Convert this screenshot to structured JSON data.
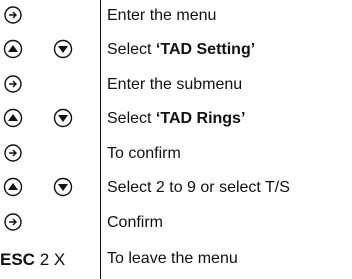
{
  "steps": [
    {
      "keys": [
        "ok-icon"
      ],
      "text": "Enter the menu"
    },
    {
      "keys": [
        "up-icon",
        "down-icon"
      ],
      "text": "Select ",
      "bold": "‘TAD Setting’"
    },
    {
      "keys": [
        "ok-icon"
      ],
      "text": "Enter the submenu"
    },
    {
      "keys": [
        "up-icon",
        "down-icon"
      ],
      "text": "Select ",
      "bold": "‘TAD Rings’"
    },
    {
      "keys": [
        "ok-icon"
      ],
      "text": "To confirm"
    },
    {
      "keys": [
        "up-icon",
        "down-icon"
      ],
      "text": "Select 2 to 9 or select T/S"
    },
    {
      "keys": [
        "ok-icon"
      ],
      "text": "Confirm"
    },
    {
      "key_label": "ESC",
      "key_count": "2 X",
      "text": "To leave the menu"
    }
  ]
}
